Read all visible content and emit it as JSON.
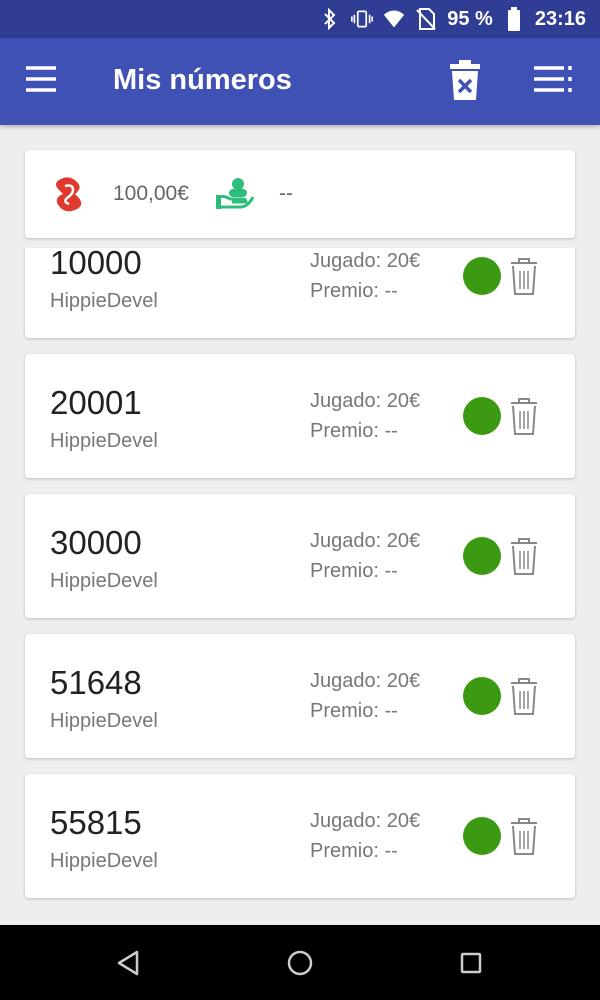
{
  "status_bar": {
    "battery": "95 %",
    "time": "23:16",
    "icons": [
      "bluetooth-icon",
      "vibrate-icon",
      "wifi-icon",
      "no-sim-icon",
      "battery-icon"
    ]
  },
  "app_bar": {
    "title": "Mis números",
    "icons": [
      "menu-icon",
      "delete-all-icon",
      "sort-icon"
    ]
  },
  "summary": {
    "total_played": "100,00€",
    "total_prize": "--",
    "icons": [
      "lottery-logo-icon",
      "prize-hand-icon"
    ]
  },
  "tickets": [
    {
      "number": "10000",
      "owner": "HippieDevel",
      "played": "Jugado: 20€",
      "prize": "Premio: --"
    },
    {
      "number": "20001",
      "owner": "HippieDevel",
      "played": "Jugado: 20€",
      "prize": "Premio: --"
    },
    {
      "number": "30000",
      "owner": "HippieDevel",
      "played": "Jugado: 20€",
      "prize": "Premio: --"
    },
    {
      "number": "51648",
      "owner": "HippieDevel",
      "played": "Jugado: 20€",
      "prize": "Premio: --"
    },
    {
      "number": "55815",
      "owner": "HippieDevel",
      "played": "Jugado: 20€",
      "prize": "Premio: --"
    }
  ],
  "colors": {
    "app_bar": "#3f51b5",
    "status_bar": "#2f3d94",
    "status_dot": "#3c9a12",
    "logo_red": "#e03a2f",
    "prize_green": "#2ebd7a"
  },
  "nav_bar": {
    "icons": [
      "back-icon",
      "home-icon",
      "recents-icon"
    ]
  }
}
